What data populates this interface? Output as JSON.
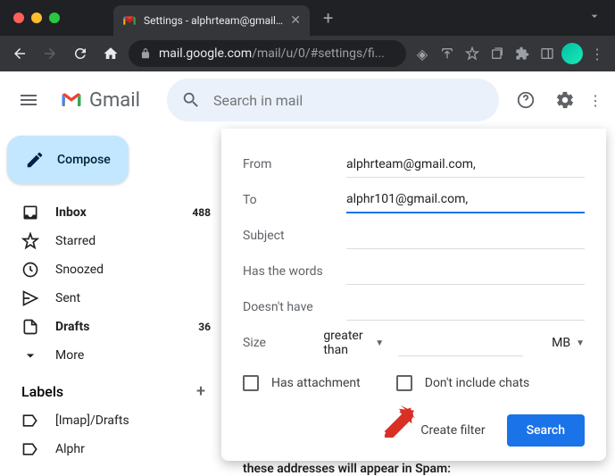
{
  "browser": {
    "tab_title": "Settings - alphrteam@gmail.co",
    "url_lock": true,
    "url_domain": "mail.google.com",
    "url_path": "/mail/u/0/#settings/fi..."
  },
  "gmail": {
    "product_name": "Gmail",
    "search_placeholder": "Search in mail"
  },
  "sidebar": {
    "compose_label": "Compose",
    "items": [
      {
        "label": "Inbox",
        "count": "488",
        "icon": "inbox"
      },
      {
        "label": "Starred",
        "count": "",
        "icon": "star"
      },
      {
        "label": "Snoozed",
        "count": "",
        "icon": "clock"
      },
      {
        "label": "Sent",
        "count": "",
        "icon": "send"
      },
      {
        "label": "Drafts",
        "count": "36",
        "icon": "draft"
      },
      {
        "label": "More",
        "count": "",
        "icon": "chevron-down"
      }
    ],
    "labels_header": "Labels",
    "labels": [
      {
        "label": "[Imap]/Drafts"
      },
      {
        "label": "Alphr"
      }
    ]
  },
  "filter": {
    "from_label": "From",
    "from_value": "alphrteam@gmail.com,",
    "to_label": "To",
    "to_value": "alphr101@gmail.com,",
    "subject_label": "Subject",
    "subject_value": "",
    "haswords_label": "Has the words",
    "haswords_value": "",
    "doesnthave_label": "Doesn't have",
    "doesnthave_value": "",
    "size_label": "Size",
    "size_comparator": "greater than",
    "size_value": "",
    "size_unit": "MB",
    "has_attachment_label": "Has attachment",
    "dont_include_chats_label": "Don't include chats",
    "create_filter_label": "Create filter",
    "search_button_label": "Search"
  },
  "background_text": "these addresses will appear in Spam:"
}
